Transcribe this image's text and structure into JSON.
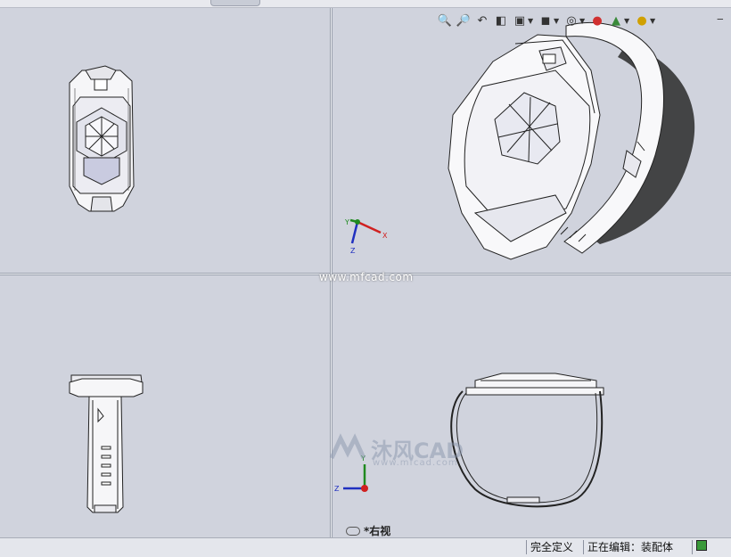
{
  "toolbar": {
    "icons": [
      "zoom-to-fit-icon",
      "zoom-area-icon",
      "previous-view-icon",
      "section-view-icon",
      "view-orientation-icon",
      "display-style-icon",
      "hide-show-items-icon",
      "edit-appearance-icon",
      "apply-scene-icon",
      "view-settings-icon"
    ],
    "minimize_glyph": "‒"
  },
  "watermark": {
    "url_text": "www.mfcad.com",
    "logo_name": "沐风CAD",
    "logo_url": "www.mfcad.com"
  },
  "triad_trimetric": {
    "x": "X",
    "y": "Y",
    "z": "Z"
  },
  "triad_right": {
    "y": "Y",
    "z": "Z"
  },
  "view_label": "*右视",
  "status": {
    "definition": "完全定义",
    "editing": "正在编辑：装配体"
  },
  "colors": {
    "viewport_bg": "#d0d3dd",
    "axis_x": "#d02020",
    "axis_y": "#1f8a1f",
    "axis_z": "#2030c0"
  }
}
